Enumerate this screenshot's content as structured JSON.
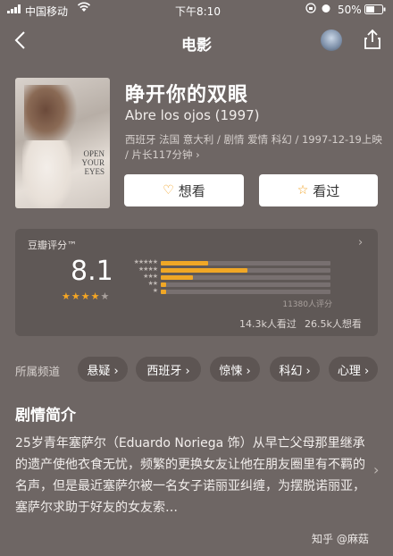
{
  "status_bar": {
    "carrier": "中国移动",
    "time": "下午8:10",
    "battery": "50%"
  },
  "nav": {
    "title": "电影"
  },
  "poster": {
    "title_text": "OPEN YOUR EYES"
  },
  "movie": {
    "title": "睁开你的双眼",
    "original_title": "Abre los ojos (1997)",
    "meta": "西班牙 法国 意大利 / 剧情 爱情 科幻 / 1997-12-19上映 / 片长117分钟 ›"
  },
  "actions": {
    "want": "想看",
    "seen": "看过"
  },
  "rating": {
    "label": "豆瓣评分™",
    "score": "8.1",
    "stars_filled": 4,
    "stars_total": 5,
    "distribution": [
      {
        "stars": "★★★★★",
        "fraction": 0.28
      },
      {
        "stars": "★★★★",
        "fraction": 0.51
      },
      {
        "stars": "★★★",
        "fraction": 0.19
      },
      {
        "stars": "★★",
        "fraction": 0.03
      },
      {
        "stars": "★",
        "fraction": 0.03
      }
    ],
    "count": "11380人评分",
    "seen_count": "14.3k人看过",
    "want_count": "26.5k人想看"
  },
  "tags": {
    "label": "所属频道",
    "items": [
      "悬疑 ›",
      "西班牙 ›",
      "惊悚 ›",
      "科幻 ›",
      "心理 ›"
    ]
  },
  "synopsis": {
    "title": "剧情简介",
    "text": "25岁青年塞萨尔（Eduardo Noriega 饰）从早亡父母那里继承的遗产使他衣食无忧，频繁的更换女友让他在朋友圈里有不羁的名声，但是最近塞萨尔被一名女子诺丽亚纠缠，为摆脱诺丽亚，塞萨尔求助于好友的女友索…"
  },
  "watermark": "知乎 @麻菇",
  "colors": {
    "accent": "#f0a726",
    "background": "#6e6664"
  }
}
